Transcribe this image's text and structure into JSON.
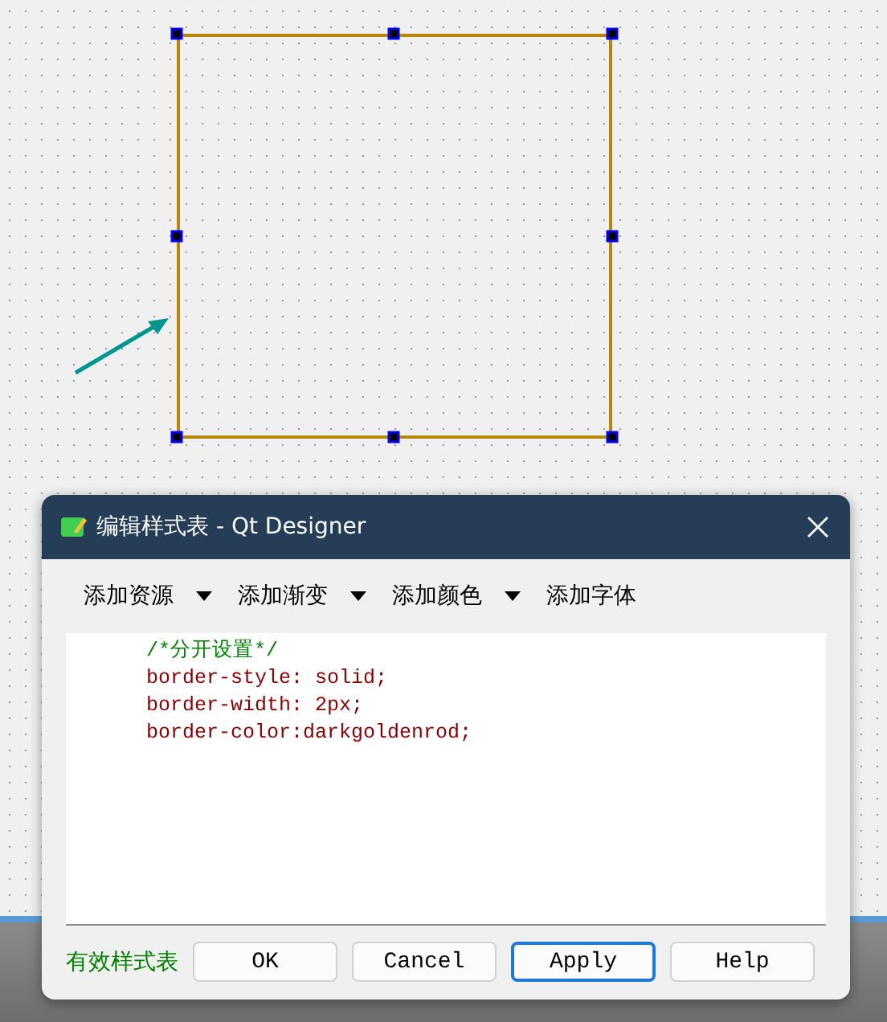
{
  "canvas": {
    "widget": {
      "kind": "frame",
      "selected": true
    }
  },
  "dialog": {
    "title": "编辑样式表 - Qt Designer",
    "toolbar": [
      {
        "label": "添加资源",
        "has_menu": true
      },
      {
        "label": "添加渐变",
        "has_menu": true
      },
      {
        "label": "添加颜色",
        "has_menu": true
      },
      {
        "label": "添加字体",
        "has_menu": false
      }
    ],
    "editor": {
      "lines": [
        {
          "kind": "comment",
          "text": "/*分开设置*/"
        },
        {
          "kind": "code",
          "text": "border-style: solid;"
        },
        {
          "kind": "code",
          "text": "border-width: 2px;"
        },
        {
          "kind": "code",
          "text": "border-color:darkgoldenrod;"
        }
      ]
    },
    "status": {
      "text": "有效样式表",
      "valid": true
    },
    "buttons": [
      {
        "label": "OK",
        "focused": false
      },
      {
        "label": "Cancel",
        "focused": false
      },
      {
        "label": "Apply",
        "focused": true
      },
      {
        "label": "Help",
        "focused": false
      }
    ]
  }
}
